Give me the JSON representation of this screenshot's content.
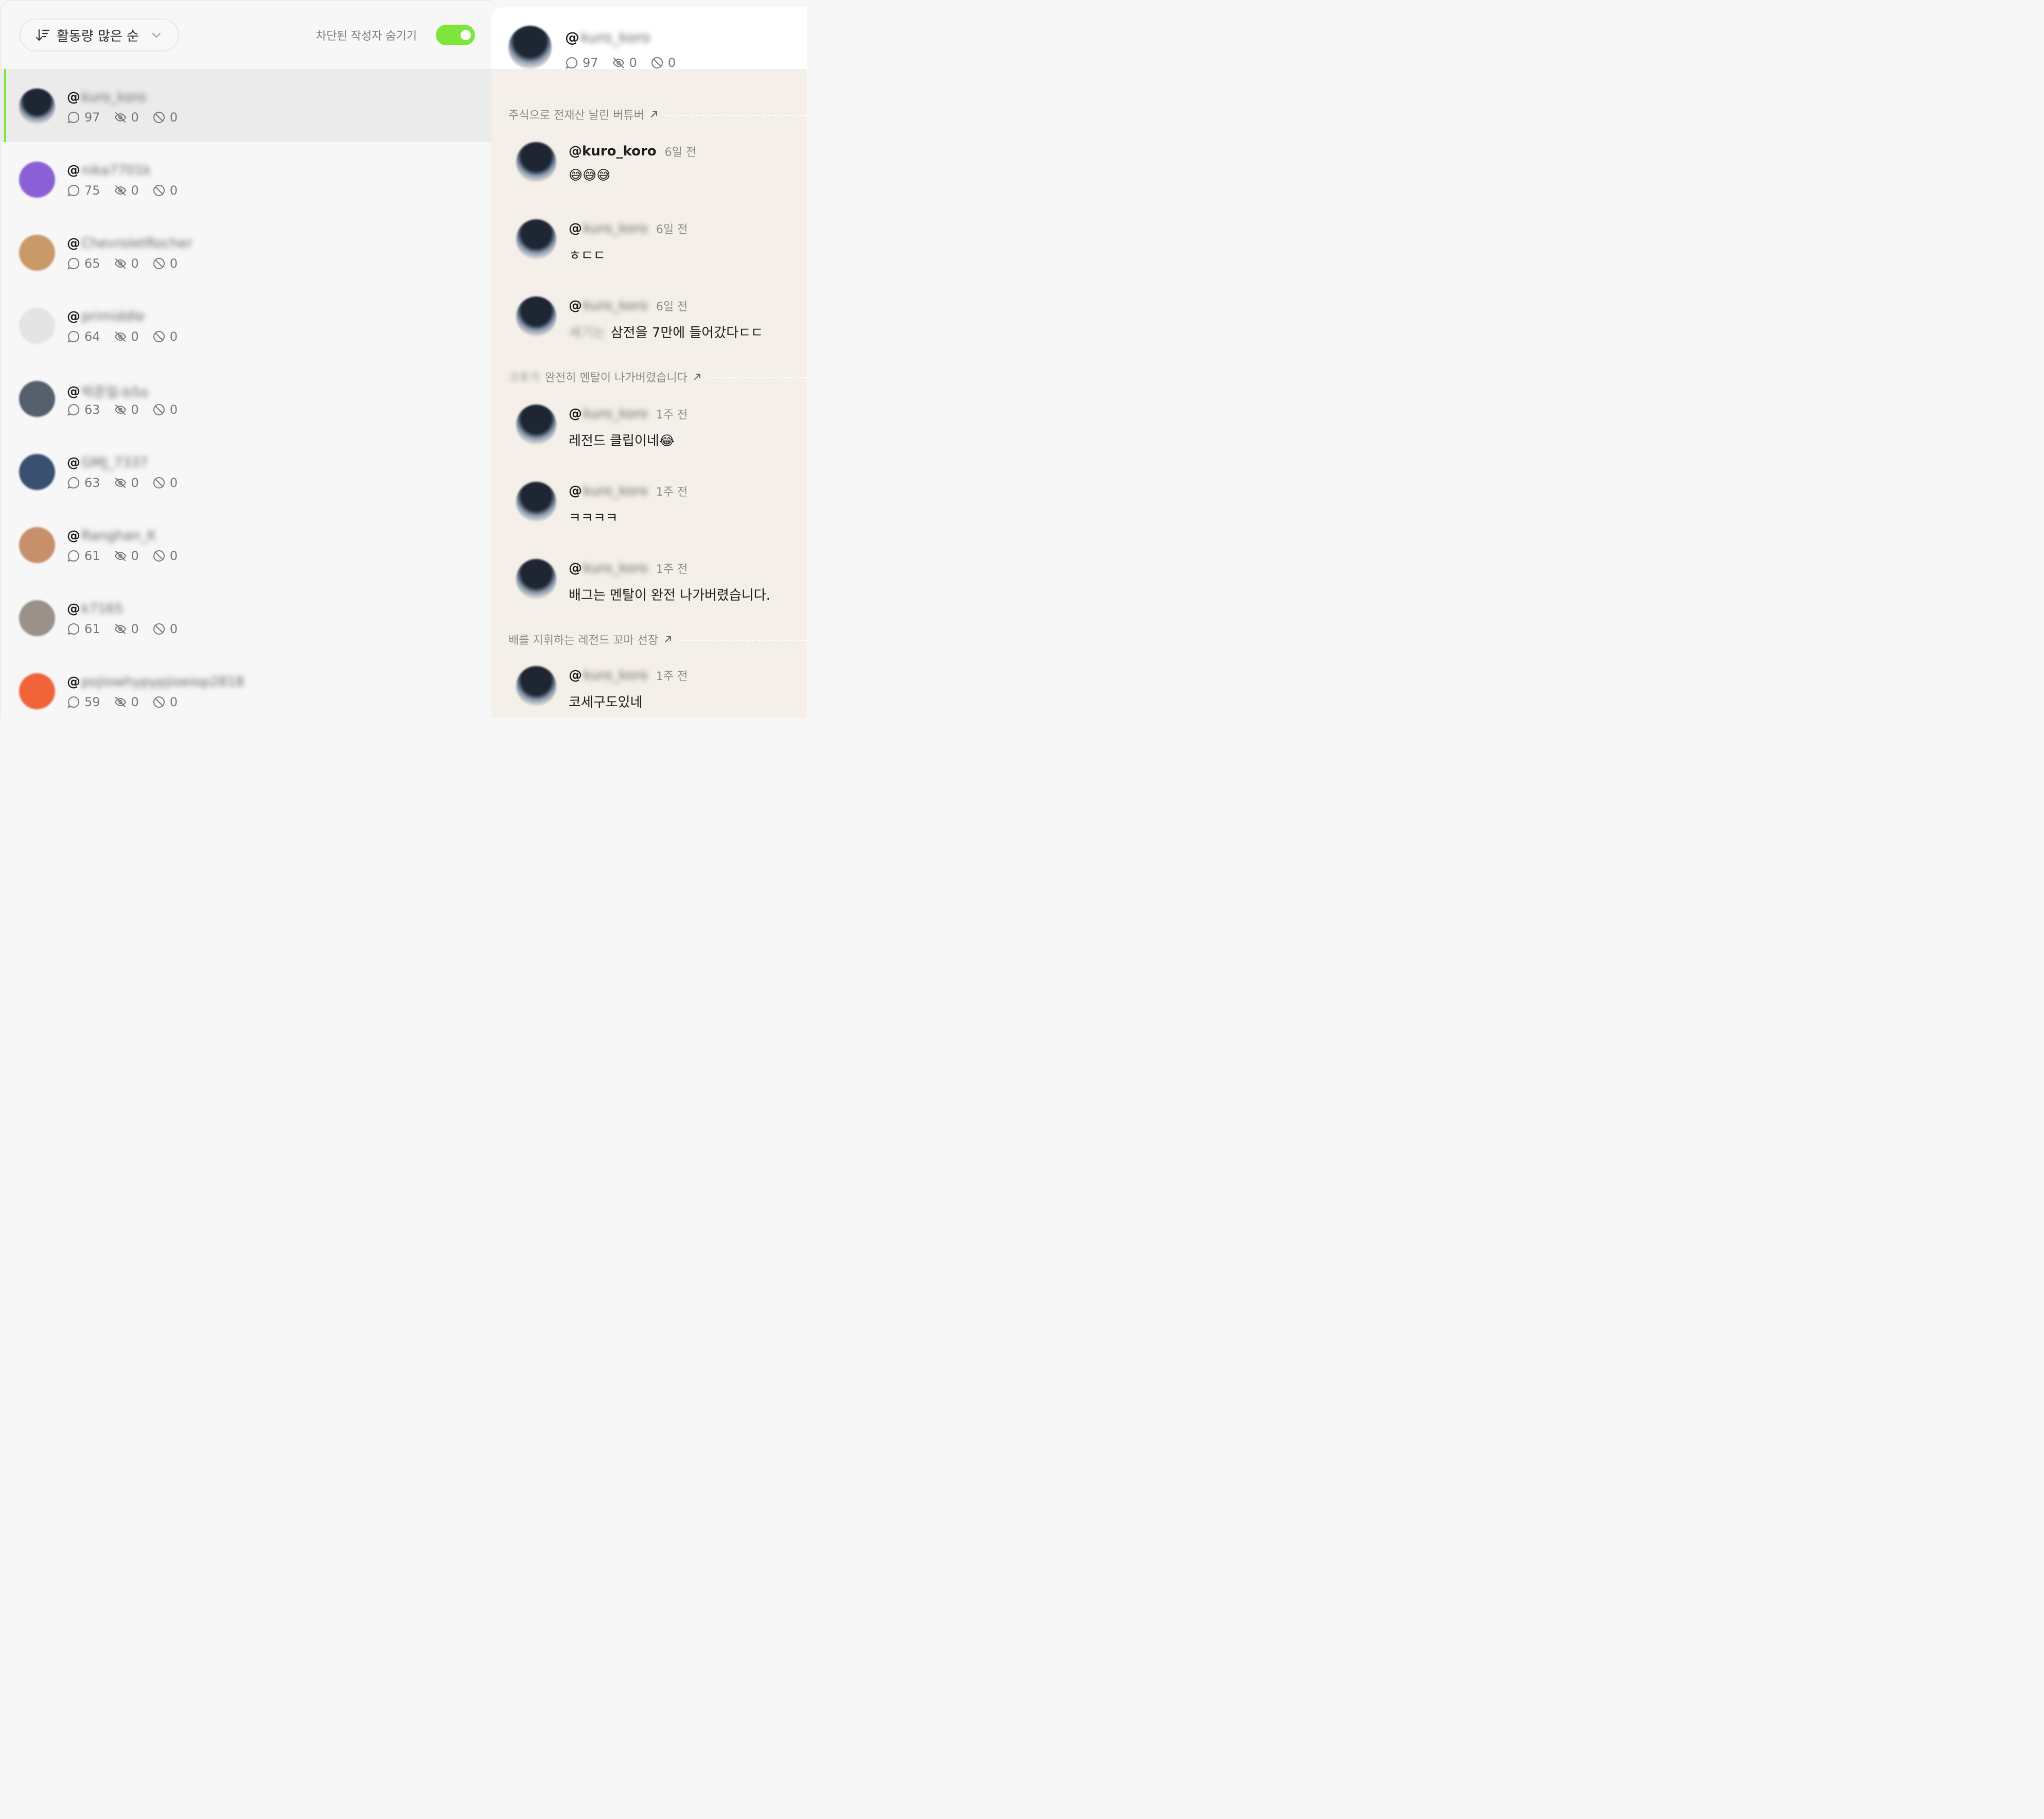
{
  "toolbar": {
    "sort_label": "활동량 많은 순",
    "hide_blocked_label": "차단된 작성자 숨기기",
    "hide_blocked_on": true,
    "accent_color": "#7ce63c"
  },
  "users": [
    {
      "at": "@",
      "handle": "kuro_koro",
      "comments": "97",
      "hidden": "0",
      "blocked": "0",
      "avatar_color": "#2f3a4a"
    },
    {
      "at": "@",
      "handle": "nika7701k",
      "comments": "75",
      "hidden": "0",
      "blocked": "0",
      "avatar_color": "#8b5fd6"
    },
    {
      "at": "@",
      "handle": "ChevroletRocher",
      "comments": "65",
      "hidden": "0",
      "blocked": "0",
      "avatar_color": "#c89a6a"
    },
    {
      "at": "@",
      "handle": "primiddle",
      "comments": "64",
      "hidden": "0",
      "blocked": "0",
      "avatar_color": "#e4e4e4"
    },
    {
      "at": "@",
      "handle": "박준일-b5o",
      "comments": "63",
      "hidden": "0",
      "blocked": "0",
      "avatar_color": "#55606e"
    },
    {
      "at": "@",
      "handle": "GMJ_7337",
      "comments": "63",
      "hidden": "0",
      "blocked": "0",
      "avatar_color": "#3b5070"
    },
    {
      "at": "@",
      "handle": "Ranghan_K",
      "comments": "61",
      "hidden": "0",
      "blocked": "0",
      "avatar_color": "#c8906a"
    },
    {
      "at": "@",
      "handle": "k7165",
      "comments": "61",
      "hidden": "0",
      "blocked": "0",
      "avatar_color": "#9a9288"
    },
    {
      "at": "@",
      "handle": "pojiowhypypjioeiop2818",
      "comments": "59",
      "hidden": "0",
      "blocked": "0",
      "avatar_color": "#f0643a"
    }
  ],
  "detail": {
    "at": "@",
    "handle": "kuro_koro",
    "comments": "97",
    "hidden": "0",
    "blocked": "0",
    "videos": [
      {
        "prefix": "",
        "title": "주식으로 전재산 날린 버튜버"
      },
      {
        "prefix": "크루가",
        "title": "완전히 멘탈이 나가버렸습니다"
      },
      {
        "prefix": "",
        "title": "배를 지휘하는 레전드 꼬마 선장"
      }
    ],
    "comments_list": [
      {
        "at": "@",
        "handle": "kuro_koro",
        "handle_blurred": false,
        "time": "6일 전",
        "prefix": "",
        "text": "😅😅😅"
      },
      {
        "at": "@",
        "handle": "kuro_koro",
        "handle_blurred": true,
        "time": "6일 전",
        "prefix": "",
        "text": "ㅎㄷㄷ"
      },
      {
        "at": "@",
        "handle": "kuro_koro",
        "handle_blurred": true,
        "time": "6일 전",
        "prefix": "세기는",
        "text": "삼전을 7만에 들어갔다ㄷㄷ"
      },
      {
        "at": "@",
        "handle": "kuro_koro",
        "handle_blurred": true,
        "time": "1주 전",
        "prefix": "",
        "text": "레전드 클립이네😂"
      },
      {
        "at": "@",
        "handle": "kuro_koro",
        "handle_blurred": true,
        "time": "1주 전",
        "prefix": "",
        "text": "ㅋㅋㅋㅋ"
      },
      {
        "at": "@",
        "handle": "kuro_koro",
        "handle_blurred": true,
        "time": "1주 전",
        "prefix": "",
        "text": "배그는 멘탈이 완전 나가버렸습니다."
      },
      {
        "at": "@",
        "handle": "kuro_koro",
        "handle_blurred": true,
        "time": "1주 전",
        "prefix": "",
        "text": "코세구도있네"
      }
    ]
  }
}
